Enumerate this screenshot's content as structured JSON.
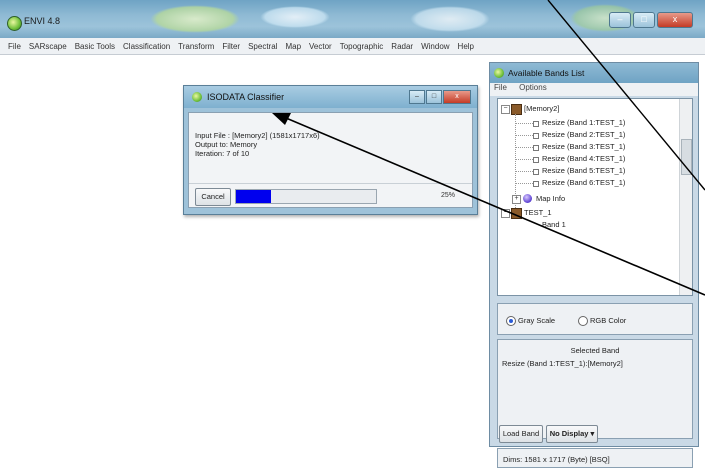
{
  "app": {
    "title": "ENVI 4.8"
  },
  "window_controls": {
    "minimize": "–",
    "maximize": "□",
    "close": "x"
  },
  "menu": [
    "File",
    "SARscape",
    "Basic Tools",
    "Classification",
    "Transform",
    "Filter",
    "Spectral",
    "Map",
    "Vector",
    "Topographic",
    "Radar",
    "Window",
    "Help"
  ],
  "bands_list": {
    "title": "Available Bands List",
    "menu": [
      "File",
      "Options"
    ],
    "tree": {
      "root_label": "[Memory2]",
      "bands": [
        "Resize (Band 1:TEST_1)",
        "Resize (Band 2:TEST_1)",
        "Resize (Band 3:TEST_1)",
        "Resize (Band 4:TEST_1)",
        "Resize (Band 5:TEST_1)",
        "Resize (Band 6:TEST_1)"
      ],
      "map_info": "Map Info",
      "second_root": "TEST_1",
      "second_child": "Band 1"
    },
    "modes": {
      "gray": "Gray Scale",
      "rgb": "RGB Color",
      "selected": "gray"
    },
    "selected_band": {
      "heading": "Selected Band",
      "value": "Resize (Band 1:TEST_1):[Memory2]"
    },
    "dims": "Dims: 1581 x 1717 (Byte) [BSQ]",
    "load_button": "Load Band",
    "display_button": "No Display"
  },
  "dialog": {
    "title": "ISODATA Classifier",
    "input_file": "Input File : [Memory2] (1581x1717x6)",
    "output": "Output to: Memory",
    "iteration": "Iteration: 7 of 10",
    "cancel": "Cancel",
    "progress": 0.25,
    "percent": "25%"
  }
}
